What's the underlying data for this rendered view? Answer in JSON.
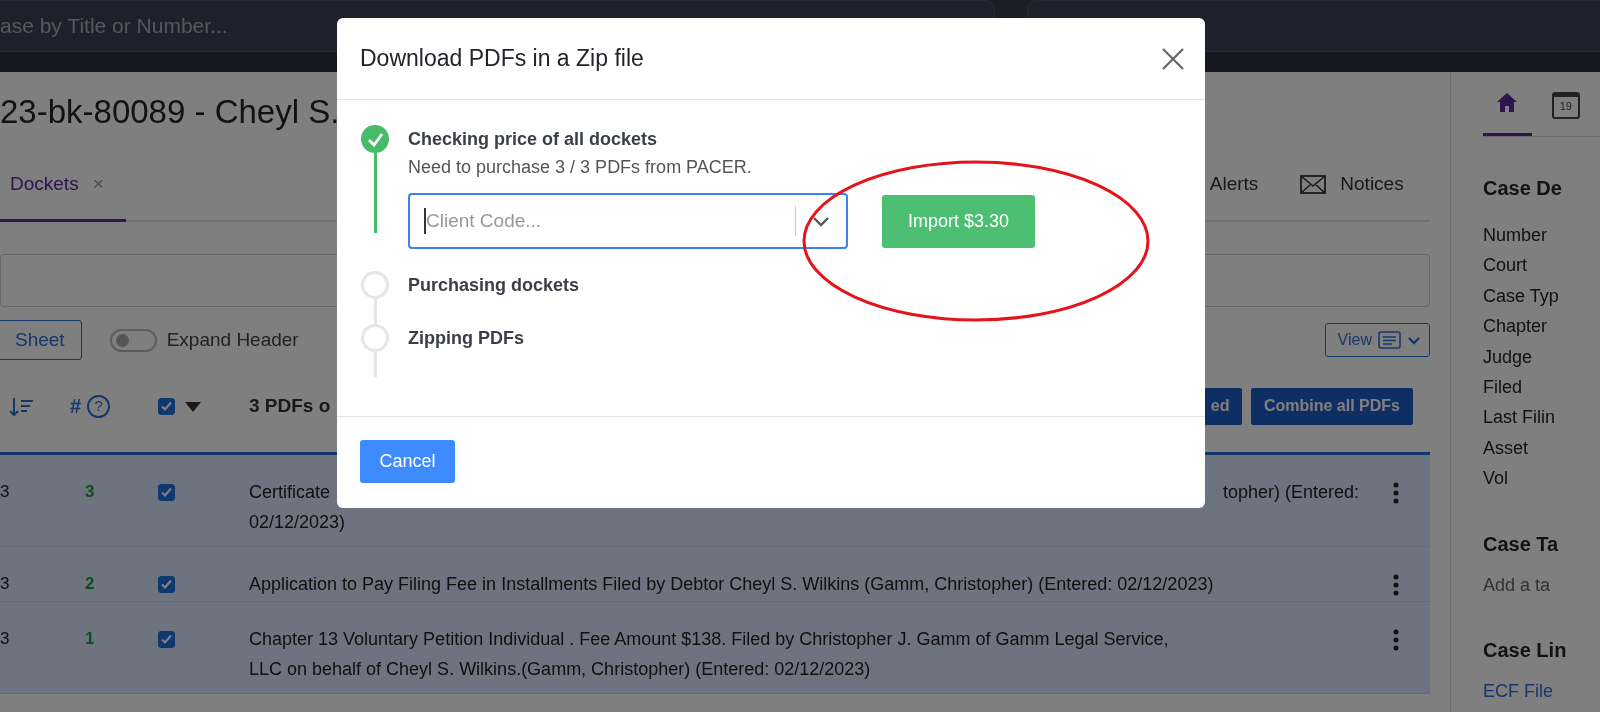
{
  "search": {
    "placeholder": "ase by Title or Number..."
  },
  "case_title": "23-bk-80089 - Cheyl S.",
  "tabs": [
    {
      "label": "Dockets",
      "close": "×",
      "kind": "plain",
      "selected": true
    },
    {
      "label": "Alerts",
      "kind": "plain",
      "selected": false
    },
    {
      "label": "Notices",
      "kind": "envelope",
      "selected": false
    }
  ],
  "toolbar": {
    "sheet_button": "Sheet",
    "expand_header": {
      "label": "Expand Header",
      "on": false
    },
    "view_button": "View"
  },
  "table": {
    "header": {
      "number": "#",
      "help": "?",
      "select_all_checked": true,
      "title": "3 PDFs o",
      "buttons": [
        "ed",
        "Combine all PDFs"
      ]
    },
    "rows": [
      {
        "column_1": "3",
        "number": "3",
        "checked": true,
        "fragments": [
          [
            "Certificate",
            "topher) (Entered:"
          ],
          [
            "02/12/2023)"
          ]
        ]
      },
      {
        "column_1": "3",
        "number": "2",
        "checked": true,
        "text": "Application to Pay Filing Fee in Installments Filed by Debtor Cheyl S. Wilkins (Gamm, Christopher) (Entered: 02/12/2023)"
      },
      {
        "column_1": "3",
        "number": "1",
        "checked": true,
        "text": "Chapter 13 Voluntary Petition Individual . Fee Amount $138. Filed by Christopher J. Gamm of Gamm Legal Service, LLC on behalf of Cheyl S. Wilkins.(Gamm, Christopher) (Entered: 02/12/2023)"
      }
    ]
  },
  "sidebar": {
    "tabs": [
      {
        "kind": "home",
        "selected": true
      },
      {
        "kind": "calendar",
        "label": "19",
        "selected": false
      }
    ],
    "sections": [
      {
        "title": "Case De",
        "items": [
          {
            "kind": "label",
            "text": "Number"
          },
          {
            "kind": "label",
            "text": "Court"
          },
          {
            "kind": "label",
            "text": "Case Typ"
          },
          {
            "kind": "label",
            "text": "Chapter"
          },
          {
            "kind": "label",
            "text": "Judge"
          },
          {
            "kind": "label",
            "text": "Filed"
          },
          {
            "kind": "label",
            "text": "Last Filin"
          },
          {
            "kind": "label",
            "text": "Asset"
          },
          {
            "kind": "label",
            "text": "Vol"
          }
        ]
      },
      {
        "title": "Case Ta",
        "items": [
          {
            "kind": "muted",
            "text": "Add a ta"
          }
        ]
      },
      {
        "title": "Case Lin",
        "items": [
          {
            "kind": "link",
            "text": "ECF File"
          }
        ]
      }
    ]
  },
  "modal": {
    "title": "Download PDFs in a Zip file",
    "steps": [
      {
        "title": "Checking price of all dockets",
        "done": true,
        "description": "Need to purchase 3 / 3 PDFs from PACER.",
        "client_code": {
          "placeholder": "Client Code..."
        },
        "action": "Import $3.30"
      },
      {
        "title": "Purchasing dockets",
        "done": false
      },
      {
        "title": "Zipping PDFs",
        "done": false
      }
    ],
    "cancel": "Cancel"
  }
}
